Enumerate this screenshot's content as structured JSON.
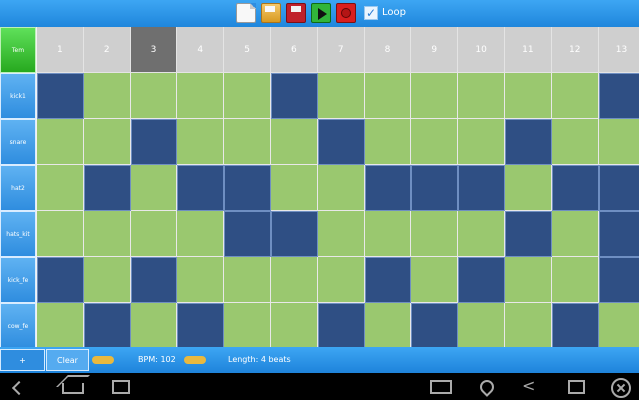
{
  "toolbar": {
    "loop_label": "Loop",
    "loop_checked": true
  },
  "grid": {
    "tempo_label": "Tem",
    "columns": [
      "1",
      "2",
      "3",
      "4",
      "5",
      "6",
      "7",
      "8",
      "9",
      "10",
      "11",
      "12",
      "13"
    ],
    "active_column": "3",
    "rows": [
      {
        "label": "kick1",
        "pattern": [
          1,
          0,
          0,
          0,
          0,
          1,
          0,
          0,
          0,
          0,
          0,
          0,
          1
        ]
      },
      {
        "label": "snare",
        "pattern": [
          0,
          0,
          1,
          0,
          0,
          0,
          1,
          0,
          0,
          0,
          1,
          0,
          0
        ]
      },
      {
        "label": "hat2",
        "pattern": [
          0,
          1,
          0,
          1,
          1,
          0,
          0,
          1,
          1,
          1,
          0,
          1,
          1
        ]
      },
      {
        "label": "hats_kit",
        "pattern": [
          0,
          0,
          0,
          0,
          1,
          1,
          0,
          0,
          0,
          0,
          1,
          0,
          1
        ]
      },
      {
        "label": "kick_fe",
        "pattern": [
          1,
          0,
          1,
          0,
          0,
          0,
          0,
          1,
          0,
          1,
          0,
          0,
          1
        ]
      },
      {
        "label": "cow_fe",
        "pattern": [
          0,
          1,
          0,
          1,
          0,
          0,
          1,
          0,
          1,
          0,
          0,
          1,
          0
        ]
      }
    ]
  },
  "bottom": {
    "add_label": "+",
    "clear_label": "Clear",
    "bpm_label": "BPM: 102",
    "length_label": "Length: 4 beats"
  },
  "nav": {
    "icons": [
      "back-icon",
      "home-icon",
      "recents-icon",
      "keyboard-icon",
      "location-icon",
      "share-icon",
      "window-icon",
      "close-icon"
    ]
  }
}
